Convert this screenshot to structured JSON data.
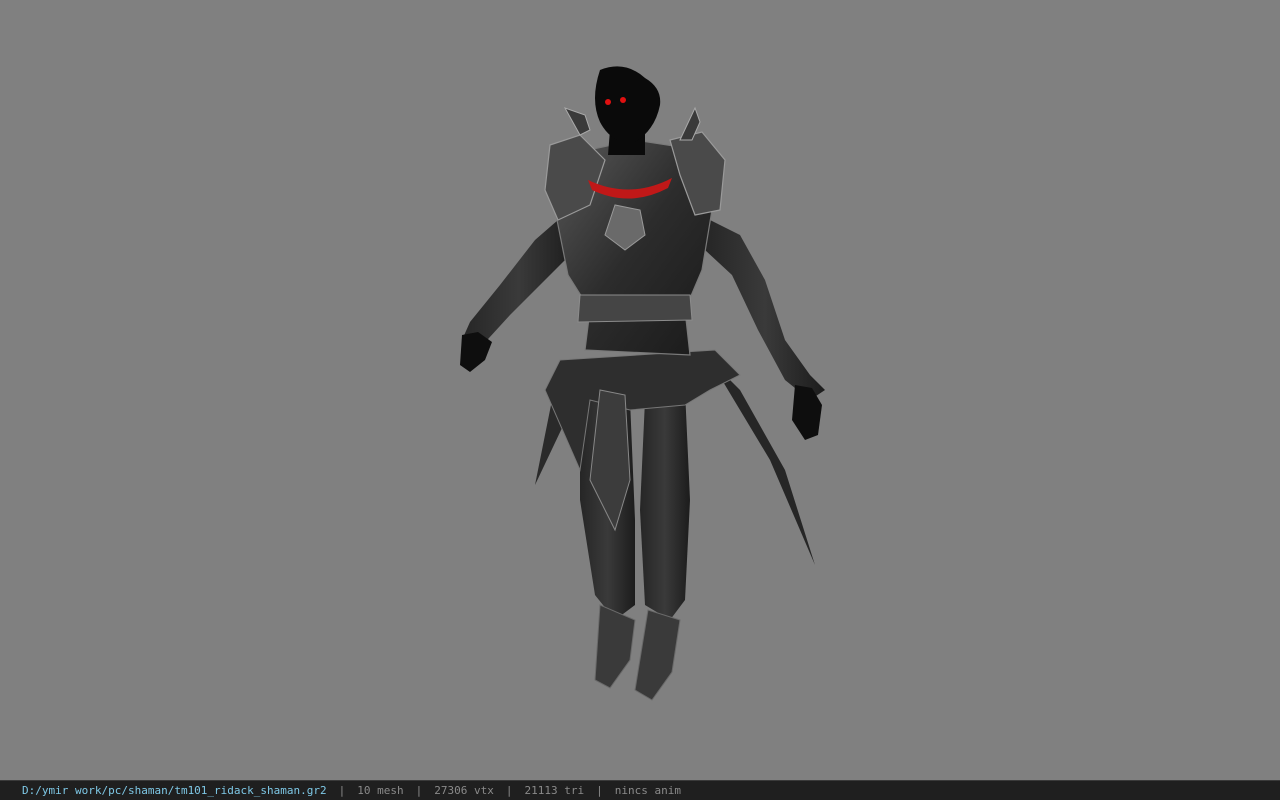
{
  "viewport": {
    "background": "#808080",
    "model": {
      "name": "shaman-armor-model",
      "eye_color": "#e01010",
      "accent_color": "#c01818"
    }
  },
  "statusbar": {
    "path": "D:/ymir work/pc/shaman/tm101_ridack_shaman.gr2",
    "separator": "|",
    "mesh": "10 mesh",
    "vtx": "27306 vtx",
    "tri": "21113 tri",
    "anim": "nincs anim",
    "path_color": "#7ec8e6"
  }
}
